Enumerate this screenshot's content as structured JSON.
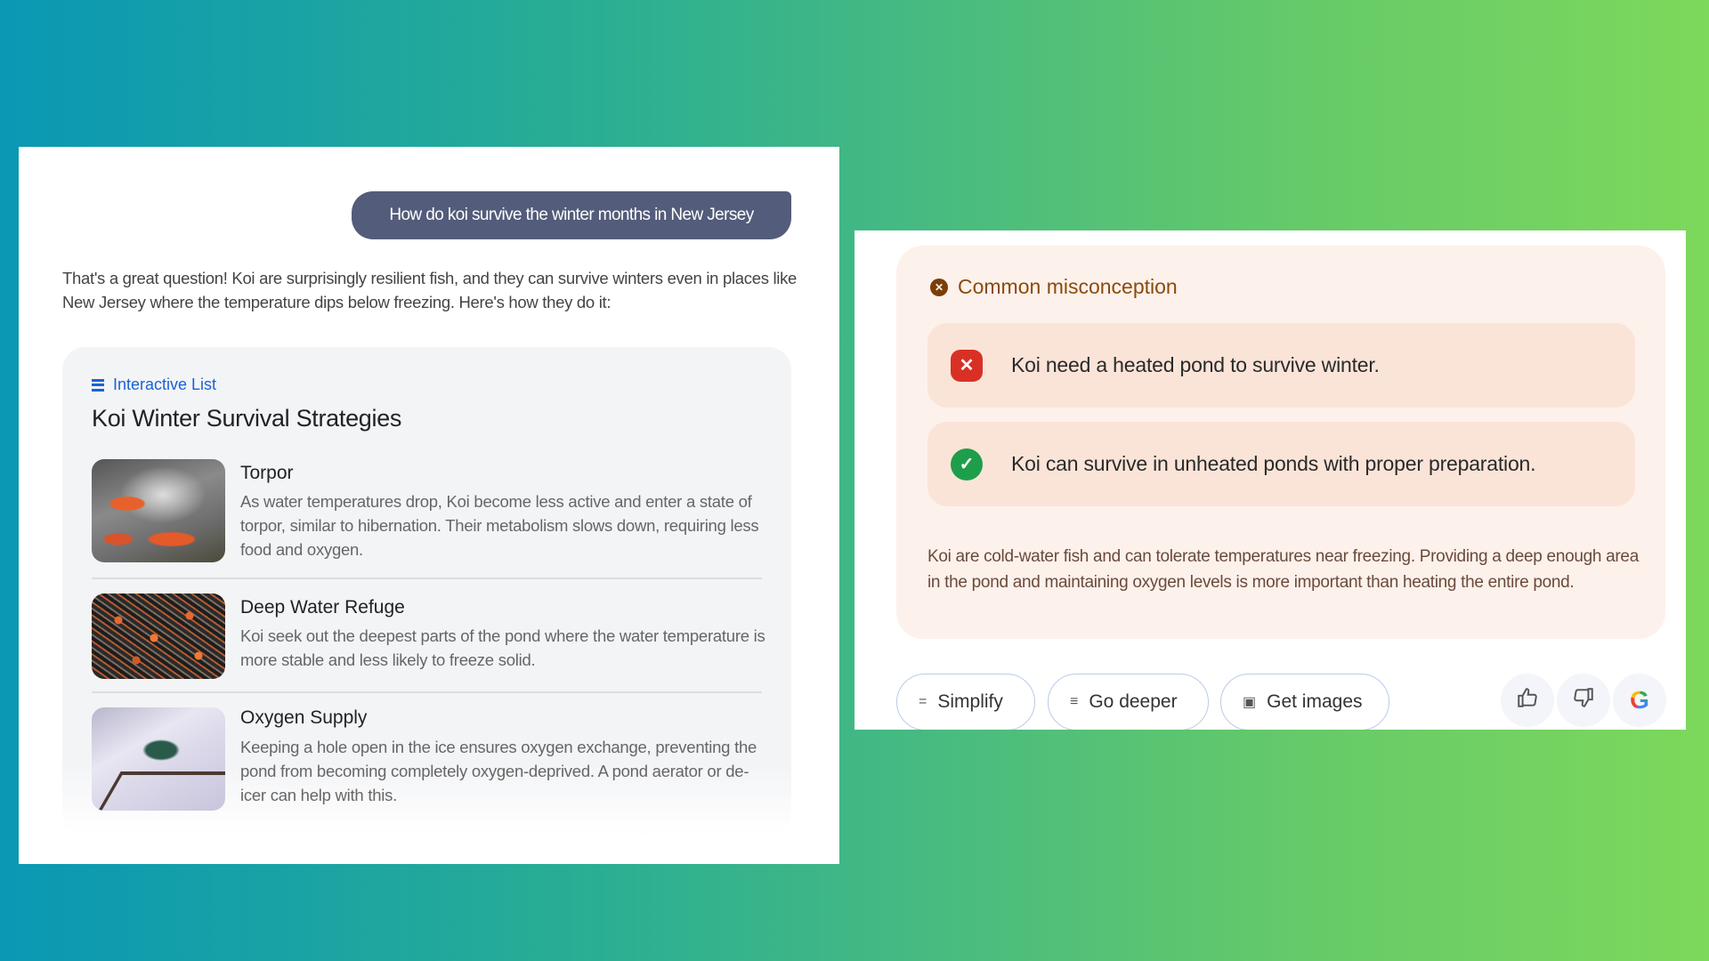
{
  "chat": {
    "user_message": "How do koi survive the winter months in New Jersey",
    "intro": "That's a great question! Koi are surprisingly resilient fish, and they can survive winters even in places like New Jersey where the temperature dips below freezing. Here's how they do it:"
  },
  "interactive_list": {
    "tag_icon": "list-icon",
    "tag_label": "Interactive List",
    "title": "Koi Winter Survival Strategies",
    "items": [
      {
        "title": "Torpor",
        "description": "As water temperatures drop, Koi become less active and enter a state of torpor, similar to hibernation. Their metabolism slows down, requiring less food and oxygen.",
        "image": "koi-in-misty-pond"
      },
      {
        "title": "Deep Water Refuge",
        "description": "Koi seek out the deepest parts of the pond where the water temperature is more stable and less likely to freeze solid.",
        "image": "koi-school-deep-water"
      },
      {
        "title": "Oxygen Supply",
        "description": "Keeping a hole open in the ice ensures oxygen exchange, preventing the pond from becoming completely oxygen-deprived. A pond aerator or de-icer can help with this.",
        "image": "frozen-pond-with-hole"
      }
    ]
  },
  "misconception": {
    "heading": "Common misconception",
    "myth": "Koi need a heated pond to survive winter.",
    "fact": "Koi can survive in unheated ponds with proper preparation.",
    "explanation": "Koi are cold-water fish and can tolerate temperatures near freezing. Providing a deep enough area in the pond and maintaining oxygen levels is more important than heating the entire pond."
  },
  "actions": {
    "simplify": "Simplify",
    "go_deeper": "Go deeper",
    "get_images": "Get images",
    "thumbs_up": "thumbs-up-icon",
    "thumbs_down": "thumbs-down-icon",
    "google": "G"
  },
  "colors": {
    "bubble": "#535c7a",
    "accent_blue": "#1a62d6",
    "myth_red": "#d93025",
    "fact_green": "#1e9e4a",
    "misconception_brown": "#8a4b0c"
  }
}
